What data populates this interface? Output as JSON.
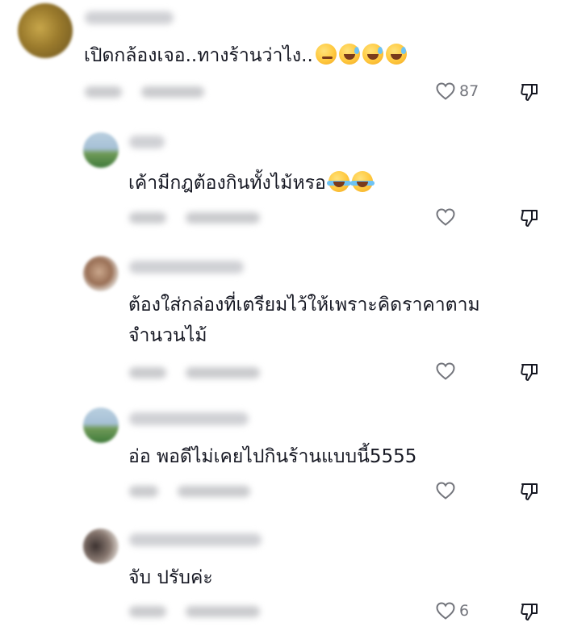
{
  "comments": [
    {
      "text": "เปิดกล้องเจอ..ทางร้านว่าไง..",
      "emojis": [
        "smirk-emoji",
        "grin-sweat-emoji",
        "grin-sweat-emoji",
        "grin-sweat-emoji"
      ],
      "likes": "87"
    },
    {
      "text": "เค้ามีกฎต้องกินทั้งไม้หรอ",
      "emojis": [
        "tears-of-joy-emoji",
        "tears-of-joy-emoji"
      ],
      "likes": ""
    },
    {
      "text_line1": "ต้องใส่กล่องที่เตรียมไว้ให้เพราะคิดราคาตาม",
      "text_line2": "จำนวนไม้",
      "likes": ""
    },
    {
      "text": "อ่อ พอดีไม่เคยไปกินร้านแบบนี้5555",
      "likes": ""
    },
    {
      "text": "จับ ปรับค่ะ",
      "likes": "6"
    }
  ],
  "icons": {
    "like": "heart-outline-icon",
    "dislike": "thumbs-down-outline-icon"
  },
  "colors": {
    "text": "#161823",
    "muted": "#73757c"
  }
}
